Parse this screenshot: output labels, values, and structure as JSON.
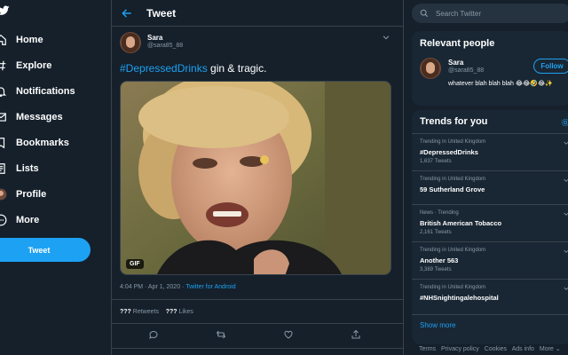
{
  "nav": {
    "items": [
      {
        "label": "Home",
        "icon": "home-icon"
      },
      {
        "label": "Explore",
        "icon": "hashtag-icon"
      },
      {
        "label": "Notifications",
        "icon": "bell-icon"
      },
      {
        "label": "Messages",
        "icon": "envelope-icon"
      },
      {
        "label": "Bookmarks",
        "icon": "bookmark-icon"
      },
      {
        "label": "Lists",
        "icon": "list-icon"
      },
      {
        "label": "Profile",
        "icon": "avatar"
      },
      {
        "label": "More",
        "icon": "more-icon"
      }
    ],
    "tweet_button": "Tweet"
  },
  "header": {
    "title": "Tweet"
  },
  "tweet": {
    "name": "Sara",
    "handle": "@sara85_88",
    "hashtag": "#DepressedDrinks",
    "text": " gin & tragic.",
    "media_badge": "GIF",
    "time": "4:04 PM · Apr 1, 2020 · ",
    "source": "Twitter for Android",
    "retweets_count": "???",
    "retweets_label": " Retweets",
    "likes_count": "???",
    "likes_label": " Likes"
  },
  "search": {
    "placeholder": "Search Twitter"
  },
  "relevant": {
    "title": "Relevant people",
    "name": "Sara",
    "handle": "@sara85_88",
    "follow_label": "Follow",
    "bio": "whatever blah blah blah 😂😂🤣😂✨"
  },
  "trends": {
    "title": "Trends for you",
    "items": [
      {
        "context": "Trending in United Kingdom",
        "name": "#DepressedDrinks",
        "count": "1,637 Tweets"
      },
      {
        "context": "Trending in United Kingdom",
        "name": "59 Sutherland Grove",
        "count": ""
      },
      {
        "context": "News · Trending",
        "name": "British American Tobacco",
        "count": "2,161 Tweets"
      },
      {
        "context": "Trending in United Kingdom",
        "name": "Another 563",
        "count": "3,389 Tweets"
      },
      {
        "context": "Trending in United Kingdom",
        "name": "#NHSnightingalehospital",
        "count": ""
      }
    ],
    "show_more": "Show more"
  },
  "footer": {
    "links": [
      "Terms",
      "Privacy policy",
      "Cookies",
      "Ads info",
      "More ⌄"
    ]
  },
  "colors": {
    "background": "#15202b",
    "accent": "#1da1f2",
    "card": "#192734",
    "muted": "#8899a6",
    "border": "#38444d"
  }
}
